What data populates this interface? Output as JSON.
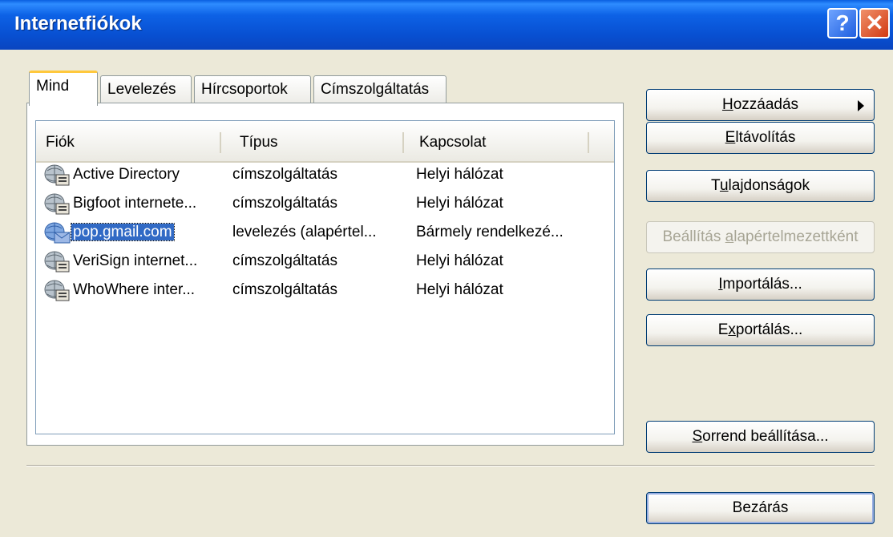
{
  "window": {
    "title": "Internetfiókok"
  },
  "tabs": [
    {
      "label": "Mind",
      "active": true
    },
    {
      "label": "Levelezés",
      "active": false
    },
    {
      "label": "Hírcsoportok",
      "active": false
    },
    {
      "label": "Címszolgáltatás",
      "active": false
    }
  ],
  "list": {
    "columns": [
      "Fiók",
      "Típus",
      "Kapcsolat"
    ],
    "rows": [
      {
        "name": "Active Directory",
        "type": "címszolgáltatás",
        "connection": "Helyi hálózat",
        "icon": "directory-service-icon"
      },
      {
        "name": "Bigfoot internete...",
        "type": "címszolgáltatás",
        "connection": "Helyi hálózat",
        "icon": "directory-service-icon"
      },
      {
        "name": "pop.gmail.com",
        "type": "levelezés (alapértel...",
        "connection": "Bármely rendelkezé...",
        "icon": "mail-account-icon",
        "selected": true
      },
      {
        "name": "VeriSign internet...",
        "type": "címszolgáltatás",
        "connection": "Helyi hálózat",
        "icon": "directory-service-icon"
      },
      {
        "name": "WhoWhere inter...",
        "type": "címszolgáltatás",
        "connection": "Helyi hálózat",
        "icon": "directory-service-icon"
      }
    ]
  },
  "buttons": {
    "add": {
      "pre": "",
      "key": "H",
      "post": "ozzáadás"
    },
    "remove": {
      "pre": "",
      "key": "E",
      "post": "ltávolítás"
    },
    "properties": {
      "pre": "T",
      "key": "u",
      "post": "lajdonságok"
    },
    "set_default": {
      "pre": "Beállítás ",
      "key": "a",
      "post": "lapértelmezettként"
    },
    "import": {
      "pre": "",
      "key": "I",
      "post": "mportálás..."
    },
    "export": {
      "pre": "E",
      "key": "x",
      "post": "portálás..."
    },
    "order": {
      "pre": "",
      "key": "S",
      "post": "orrend beállítása..."
    },
    "close": {
      "label": "Bezárás"
    }
  },
  "colors": {
    "title_bar": "#0A5FE0",
    "selection": "#316AC5",
    "dialog_bg": "#ECE9D8"
  }
}
